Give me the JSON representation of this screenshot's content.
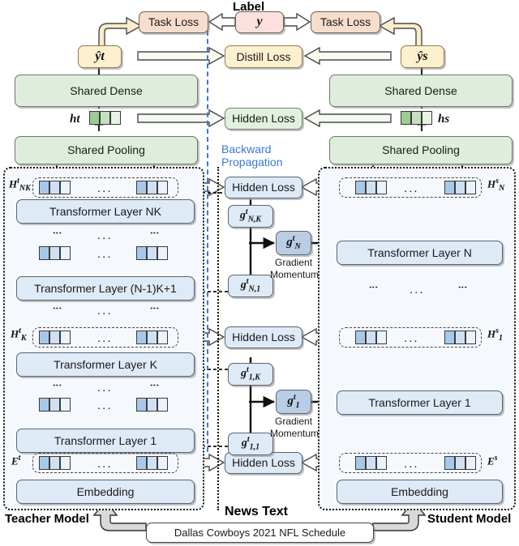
{
  "diagram": {
    "title_label": "Label",
    "news_text_label": "News Text",
    "backward_prop_line1": "Backward",
    "backward_prop_line2": "Propagation",
    "teacher_model_label": "Teacher Model",
    "student_model_label": "Student Model",
    "news_text_value": "Dallas Cowboys 2021 NFL Schedule"
  },
  "losses": {
    "task_loss": "Task Loss",
    "distill_loss": "Distill Loss",
    "hidden_loss": "Hidden Loss",
    "label_y": "y"
  },
  "shared": {
    "dense": "Shared Dense",
    "pooling": "Shared Pooling",
    "embedding": "Embedding"
  },
  "teacher": {
    "pred": "ŷt",
    "hidden_vec": "ht",
    "layers": [
      {
        "name": "Transformer Layer NK",
        "hidden": "HtNK"
      },
      {
        "name": "Transformer Layer (N-1)K+1",
        "hidden": ""
      },
      {
        "name": "Transformer Layer K",
        "hidden": "HtK"
      },
      {
        "name": "Transformer Layer 1",
        "hidden": ""
      }
    ],
    "embedding_out": "Et"
  },
  "student": {
    "pred": "ŷs",
    "hidden_vec": "hs",
    "layers": [
      {
        "name": "Transformer Layer N",
        "hidden": "HsN"
      },
      {
        "name": "Transformer Layer 1",
        "hidden": "Hs1"
      }
    ],
    "embedding_out": "Es"
  },
  "gradients": {
    "momentum_line1": "Gradient",
    "momentum_line2": "Momentum",
    "upper": {
      "top": "gtN,K",
      "bottom": "gtN,1",
      "merged": "gtN"
    },
    "lower": {
      "top": "gt1,K",
      "bottom": "gt1,1",
      "merged": "gt1"
    }
  },
  "colors": {
    "blue_box": "#dfeaf7",
    "green_box": "#dfeedc",
    "peach_box": "#f7ddcb",
    "pink_box": "#fbe0de",
    "cream_box": "#fdf0cf",
    "gradient_box": "#b9cde4",
    "backward_dash": "#3b79d6",
    "token_blue": "#a8c8e8",
    "token_green": "#9ecb93"
  },
  "ellipsis": "..."
}
